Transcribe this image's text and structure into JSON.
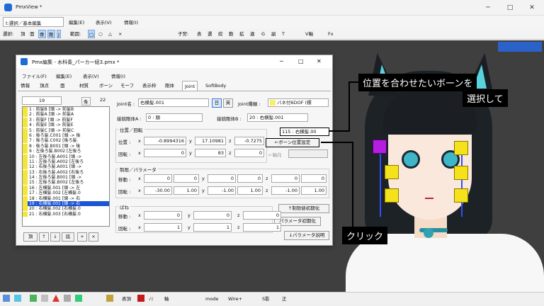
{
  "outer": {
    "title": "PmxView *",
    "mode_select": "t:選択／基本編集",
    "menu": [
      "編集(E)",
      "表示(V)",
      "情報(I)"
    ],
    "toolbar": [
      "選択:",
      "頂",
      "面",
      "骨",
      "剛",
      "J",
      "範囲:",
      "□",
      "○",
      "△",
      "×",
      "子宮:",
      "表",
      "選",
      "絞",
      "動",
      "拡",
      "違",
      "G",
      "副",
      "T",
      "V軸",
      "Fx"
    ],
    "status": [
      "表頂",
      "ﾉﾐ",
      "軸",
      "Wire+",
      "mode",
      "S影",
      "正"
    ]
  },
  "editor": {
    "title": "Pmx編集 - 水科奏_パーカー紐3.pmx *",
    "menu": [
      "ファイル(F)",
      "編集(E)",
      "表示(V)",
      "情報(I)"
    ],
    "tabs": [
      "情報",
      "頂点",
      "面",
      "材質",
      "ボーン",
      "モーフ",
      "表示枠",
      "剛体",
      "Joint",
      "SoftBody"
    ],
    "active_tab": "Joint",
    "list_index": "19",
    "list_label_kan": "条",
    "list_count": "22",
    "joint_items": [
      "1 : 前髪B [頭 -> 前髪B",
      "2 : 前髪A [頭 -> 前髪A",
      "3 : 前髪F [頭 -> 前髪F",
      "4 : 前髪E [頭 -> 前髪E",
      "5 : 前髪C [頭 -> 前髪C",
      "6 : 後ろ髪.C001 [頭 -> 後",
      "7 : 後ろ髪.C002 [後ろ髪.",
      "8 : 後ろ髪.B001 [頭 -> 後",
      "9 : 左後ろ髪.B002 [左後ろ",
      "10 : 左後ろ髪.A001 [頭 ->",
      "11 : 左後ろ髪.A002 [左後ろ",
      "12 : 右後ろ髪.A001 [頭 ->",
      "13 : 右後ろ髪.A002 [右後ろ",
      "14 : 左後ろ髪.B001 [頭 ->",
      "15 : 左後ろ髪.B002 [左後ろ",
      "16 : 左横髪.001 [頭 -> 左",
      "17 : 左横髪.002 [左横髪.0",
      "18 : 右横髪.001 [頭 -> 右",
      "19 : 右横髪.001 [頭 -> 右",
      "20 : 右横髪.002 [右横髪.0",
      "21 : 右横髪.003 [右横髪.0"
    ],
    "selected_index": 18,
    "list_buttons": [
      "頂",
      "↑",
      "↓",
      "底",
      "+",
      "×"
    ],
    "joint_name_label": "Joint名 :",
    "joint_name": "右横髪.001",
    "jp_btn": "日",
    "en_btn": "英",
    "joint_type_label": "Joint種類 :",
    "joint_type": "バネ付6DOF (標",
    "rigid_a_label": "接続剛体A :",
    "rigid_a": "0 : 頭",
    "rigid_b_label": "接続剛体B :",
    "rigid_b": "20 : 右横髪.001",
    "pos_rot_title": "位置／回転",
    "pos_label": "位置 :",
    "rot_label": "回転 :",
    "pos": [
      "-0.8994316",
      "17.10981",
      "-0.7275"
    ],
    "rot": [
      "0",
      "83",
      "0"
    ],
    "bone_select": "115 : 右横髪.00",
    "bone_align_btn": "←ボーン位置設定",
    "axis_label": "←軸向",
    "limit_title": "制限／パラメータ",
    "move_label": "移動 :",
    "rot2_label": "回転 :",
    "move_limits": [
      "0",
      "0",
      "0",
      "0",
      "0",
      "0"
    ],
    "rot_limits": [
      "-30.00",
      "1.00",
      "-1.00",
      "1.00",
      "-1.00",
      "1.00"
    ],
    "limit_reset_btn": "↑制限値初期化",
    "spring_title": "ばね",
    "spring_move": [
      "0",
      "0",
      "0"
    ],
    "spring_rot": [
      "1",
      "1",
      "1"
    ],
    "param_reset_btn": "パラメータ初期化",
    "param_desc_btn": "↓パラメータ説明",
    "axis_x": "x",
    "axis_y": "y",
    "axis_z": "z"
  },
  "annotations": {
    "line1": "位置を合わせたいボーンを",
    "line2": "選択して",
    "click": "クリック"
  },
  "colors": {
    "accent": "#1a55d8",
    "bone": "#f6e21a",
    "selected_bone": "#b31ee0",
    "hair_cyan": "#58d2dc"
  }
}
